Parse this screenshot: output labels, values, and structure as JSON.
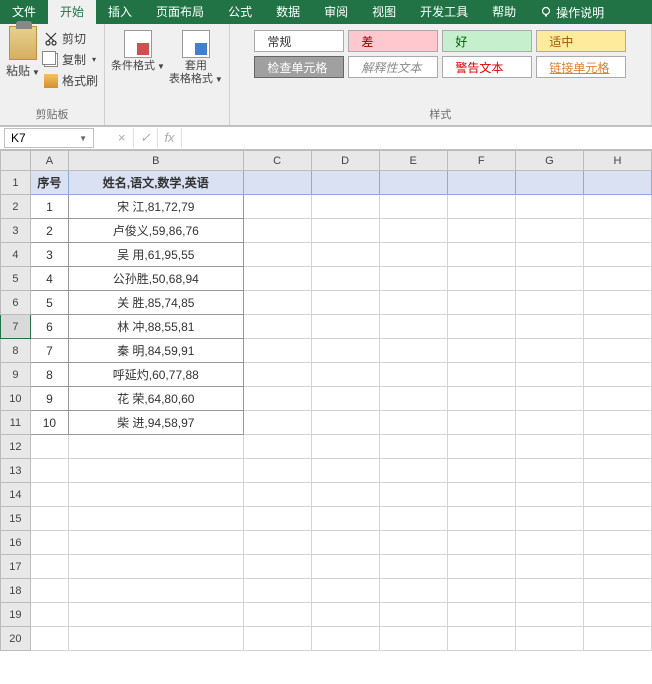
{
  "tabs": {
    "file": "文件",
    "home": "开始",
    "insert": "插入",
    "layout": "页面布局",
    "formula": "公式",
    "data": "数据",
    "review": "审阅",
    "view": "视图",
    "dev": "开发工具",
    "help": "帮助",
    "search": "操作说明"
  },
  "ribbon": {
    "paste": "粘贴",
    "cut": "剪切",
    "copy": "复制",
    "format_painter": "格式刷",
    "clipboard_label": "剪贴板",
    "cond_format": "条件格式",
    "table_format": "套用\n表格格式",
    "style_normal": "常规",
    "style_bad": "差",
    "style_good": "好",
    "style_neutral": "适中",
    "style_check": "检查单元格",
    "style_explain": "解释性文本",
    "style_warn": "警告文本",
    "style_link": "链接单元格",
    "styles_label": "样式"
  },
  "formula_bar": {
    "namebox": "K7",
    "cancel": "×",
    "enter": "✓",
    "fx": "fx",
    "value": ""
  },
  "grid": {
    "cols": [
      "A",
      "B",
      "C",
      "D",
      "E",
      "F",
      "G",
      "H"
    ],
    "rows": [
      "1",
      "2",
      "3",
      "4",
      "5",
      "6",
      "7",
      "8",
      "9",
      "10",
      "11",
      "12",
      "13",
      "14",
      "15",
      "16",
      "17",
      "18",
      "19",
      "20"
    ],
    "selected_row": "7",
    "header": {
      "A": "序号",
      "B": "姓名,语文,数学,英语"
    },
    "data": [
      {
        "A": "1",
        "B": "宋  江,81,72,79"
      },
      {
        "A": "2",
        "B": "卢俊义,59,86,76"
      },
      {
        "A": "3",
        "B": "吴  用,61,95,55"
      },
      {
        "A": "4",
        "B": "公孙胜,50,68,94"
      },
      {
        "A": "5",
        "B": "关  胜,85,74,85"
      },
      {
        "A": "6",
        "B": "林  冲,88,55,81"
      },
      {
        "A": "7",
        "B": "秦  明,84,59,91"
      },
      {
        "A": "8",
        "B": "呼延灼,60,77,88"
      },
      {
        "A": "9",
        "B": "花  荣,64,80,60"
      },
      {
        "A": "10",
        "B": "柴  进,94,58,97"
      }
    ]
  }
}
